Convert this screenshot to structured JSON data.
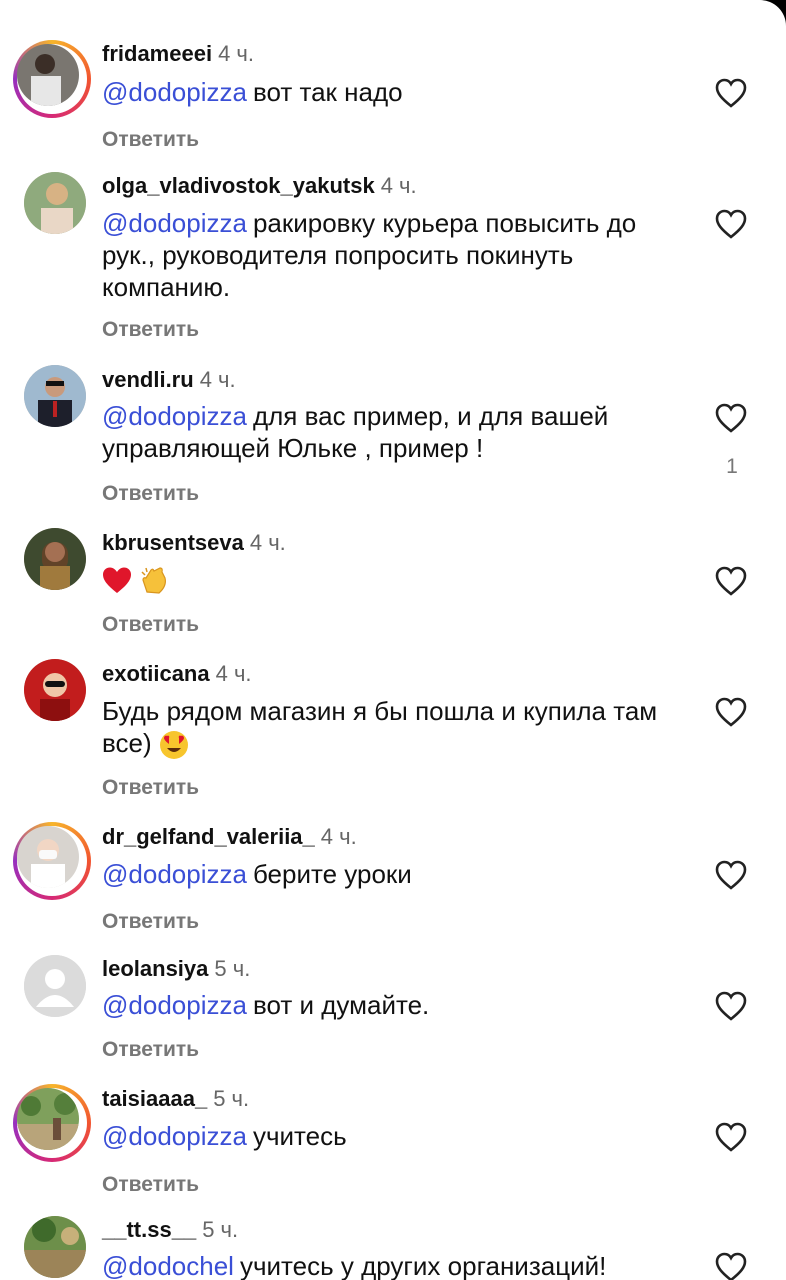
{
  "colors": {
    "mention": "#3a4fd6",
    "story_ring": [
      "#f7b52b",
      "#d62976",
      "#962fbf"
    ]
  },
  "reply_label": "Ответить",
  "comments": [
    {
      "username": "fridameeei",
      "time": "4 ч.",
      "mention": "@dodopizza",
      "text": "вот так надо",
      "story": true,
      "likes": ""
    },
    {
      "username": "olga_vladivostok_yakutsk",
      "time": "4 ч.",
      "mention": "@dodopizza",
      "text": "ракировку курьера повысить до рук., руководителя попросить покинуть компанию.",
      "story": false,
      "likes": ""
    },
    {
      "username": "vendli.ru",
      "time": "4 ч.",
      "mention": "@dodopizza",
      "text": "для вас пример, и для вашей управляющей Юльке , пример !",
      "story": false,
      "likes": "1"
    },
    {
      "username": "kbrusentseva",
      "time": "4 ч.",
      "mention": "",
      "text": "",
      "emojis": [
        "red-heart-emoji",
        "clapping-hands-emoji"
      ],
      "story": false,
      "likes": ""
    },
    {
      "username": "exotiicana",
      "time": "4 ч.",
      "mention": "",
      "text": "Будь рядом магазин я бы пошла и купила там все)",
      "emojis": [
        "heart-eyes-emoji"
      ],
      "story": false,
      "likes": ""
    },
    {
      "username": "dr_gelfand_valeriia_",
      "time": "4 ч.",
      "mention": "@dodopizza",
      "text": "берите уроки",
      "story": true,
      "likes": ""
    },
    {
      "username": "leolansiya",
      "time": "5 ч.",
      "mention": "@dodopizza",
      "text": "вот и думайте.",
      "story": false,
      "likes": ""
    },
    {
      "username": "taisiaaaa_",
      "time": "5 ч.",
      "mention": "@dodopizza",
      "text": "учитесь",
      "story": true,
      "likes": ""
    },
    {
      "username": "__tt.ss__",
      "time": "5 ч.",
      "mention": "@dodochel",
      "text": "учитесь у других организаций!",
      "story": false,
      "likes": ""
    }
  ]
}
